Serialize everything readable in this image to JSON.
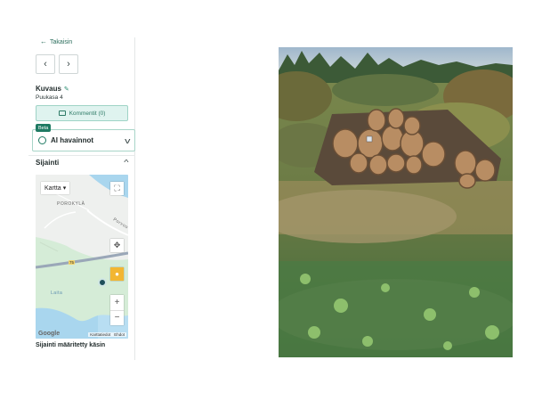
{
  "nav": {
    "back_label": "Takaisin",
    "prev_icon": "chevron-left-icon",
    "next_icon": "chevron-right-icon"
  },
  "description": {
    "title": "Kuvaus",
    "value": "Puukasa 4"
  },
  "comments": {
    "label": "Kommentit (0)"
  },
  "ai": {
    "badge": "Beta",
    "label": "AI havainnot"
  },
  "location": {
    "title": "Sijainti",
    "map": {
      "type_label": "Kartta",
      "place_label": "POROKYLÄ",
      "road_label": "Porvoo",
      "water_label": "Laita",
      "road_number": "75",
      "google_label": "Google",
      "keyboard_label": "Pikanäppäimet",
      "data_label": "Karttatiedot",
      "terms_label": "Ehdot"
    },
    "note": "Sijainti määritetty käsin"
  },
  "colors": {
    "accent": "#1f7a63",
    "accent_light": "#dff3ef"
  }
}
